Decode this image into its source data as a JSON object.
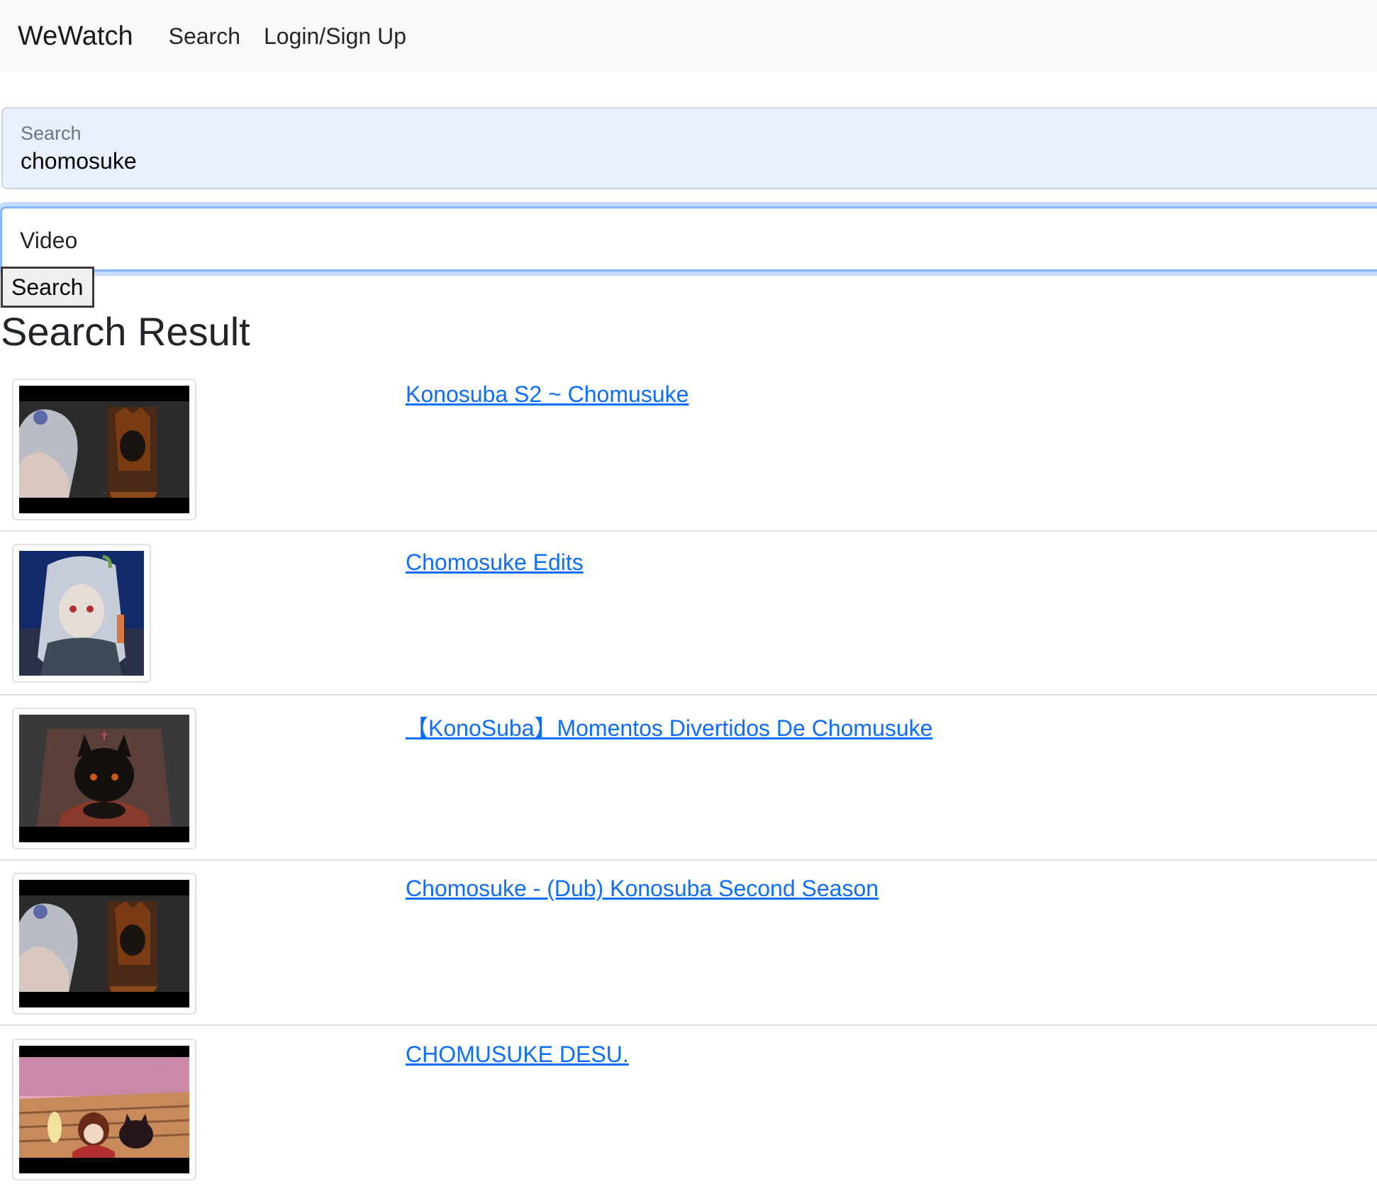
{
  "navbar": {
    "brand": "WeWatch",
    "links": [
      "Search",
      "Login/Sign Up"
    ]
  },
  "search": {
    "label": "Search",
    "value": "chomosuke"
  },
  "type_select": {
    "selected": "Video"
  },
  "search_button": {
    "label": "Search"
  },
  "results": {
    "heading": "Search Result",
    "items": [
      {
        "title": "Konosuba S2 ~ Chomusuke"
      },
      {
        "title": "Chomosuke Edits"
      },
      {
        "title": "【KonoSuba】Momentos Divertidos De Chomusuke"
      },
      {
        "title": "Chomosuke - (Dub) Konosuba Second Season"
      },
      {
        "title": "CHOMUSUKE DESU."
      }
    ]
  },
  "colors": {
    "link": "#0d6efd",
    "navbar_bg": "#f8f9fa",
    "autofill_bg": "#e8f0fe",
    "focus_border": "#86b7fe"
  }
}
